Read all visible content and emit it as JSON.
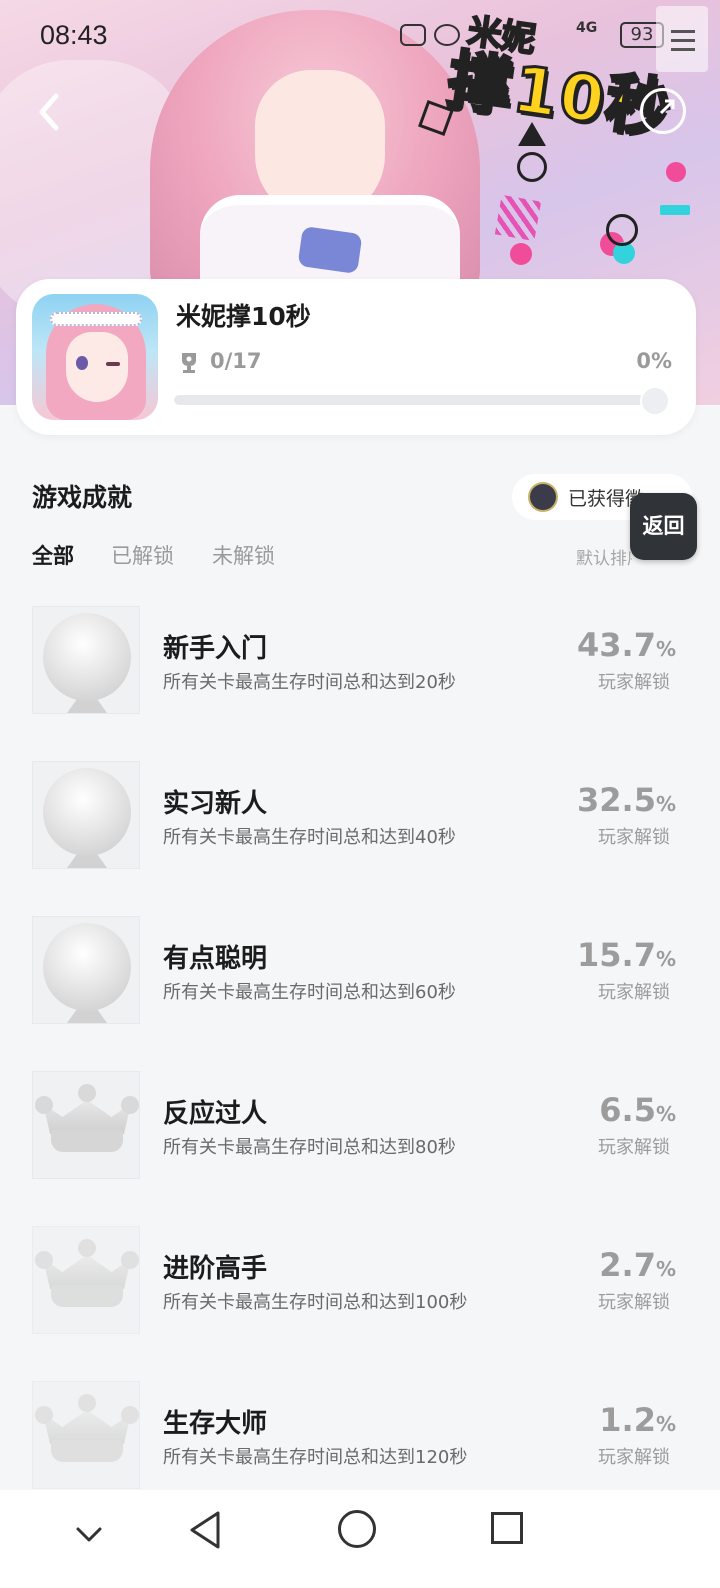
{
  "status_bar": {
    "time": "08:43",
    "battery": "93",
    "network": "4G"
  },
  "banner": {
    "title_top": "米妮",
    "title_main": "撑10秒"
  },
  "game": {
    "name": "米妮撑10秒",
    "trophy_count": "0/17",
    "progress_percent_text": "0%",
    "progress": 0
  },
  "section": {
    "title": "游戏成就",
    "earned_label": "已获得徽"
  },
  "float_button": {
    "label": "返回"
  },
  "tabs": [
    {
      "label": "全部",
      "active": true
    },
    {
      "label": "已解锁",
      "active": false
    },
    {
      "label": "未解锁",
      "active": false
    }
  ],
  "sort_label": "默认排序",
  "achievements": [
    {
      "title": "新手入门",
      "desc": "所有关卡最高生存时间总和达到20秒",
      "value": "43.7",
      "unit": "%",
      "sub": "玩家解锁",
      "badge": "medal"
    },
    {
      "title": "实习新人",
      "desc": "所有关卡最高生存时间总和达到40秒",
      "value": "32.5",
      "unit": "%",
      "sub": "玩家解锁",
      "badge": "medal"
    },
    {
      "title": "有点聪明",
      "desc": "所有关卡最高生存时间总和达到60秒",
      "value": "15.7",
      "unit": "%",
      "sub": "玩家解锁",
      "badge": "medal"
    },
    {
      "title": "反应过人",
      "desc": "所有关卡最高生存时间总和达到80秒",
      "value": "6.5",
      "unit": "%",
      "sub": "玩家解锁",
      "badge": "crown"
    },
    {
      "title": "进阶高手",
      "desc": "所有关卡最高生存时间总和达到100秒",
      "value": "2.7",
      "unit": "%",
      "sub": "玩家解锁",
      "badge": "crown"
    },
    {
      "title": "生存大师",
      "desc": "所有关卡最高生存时间总和达到120秒",
      "value": "1.2",
      "unit": "%",
      "sub": "玩家解锁",
      "badge": "crown"
    }
  ],
  "icons": {
    "back": "chevron-left-icon",
    "share": "share-icon",
    "menu": "menu-icon",
    "trophy": "trophy-icon",
    "nav_down": "chevron-down-icon",
    "nav_back": "triangle-back-icon",
    "nav_home": "circle-home-icon",
    "nav_recent": "square-recent-icon"
  },
  "colors": {
    "accent": "#2fd3c7",
    "banner_yellow": "#ffd21f",
    "text_gray": "#9a9a9a"
  }
}
